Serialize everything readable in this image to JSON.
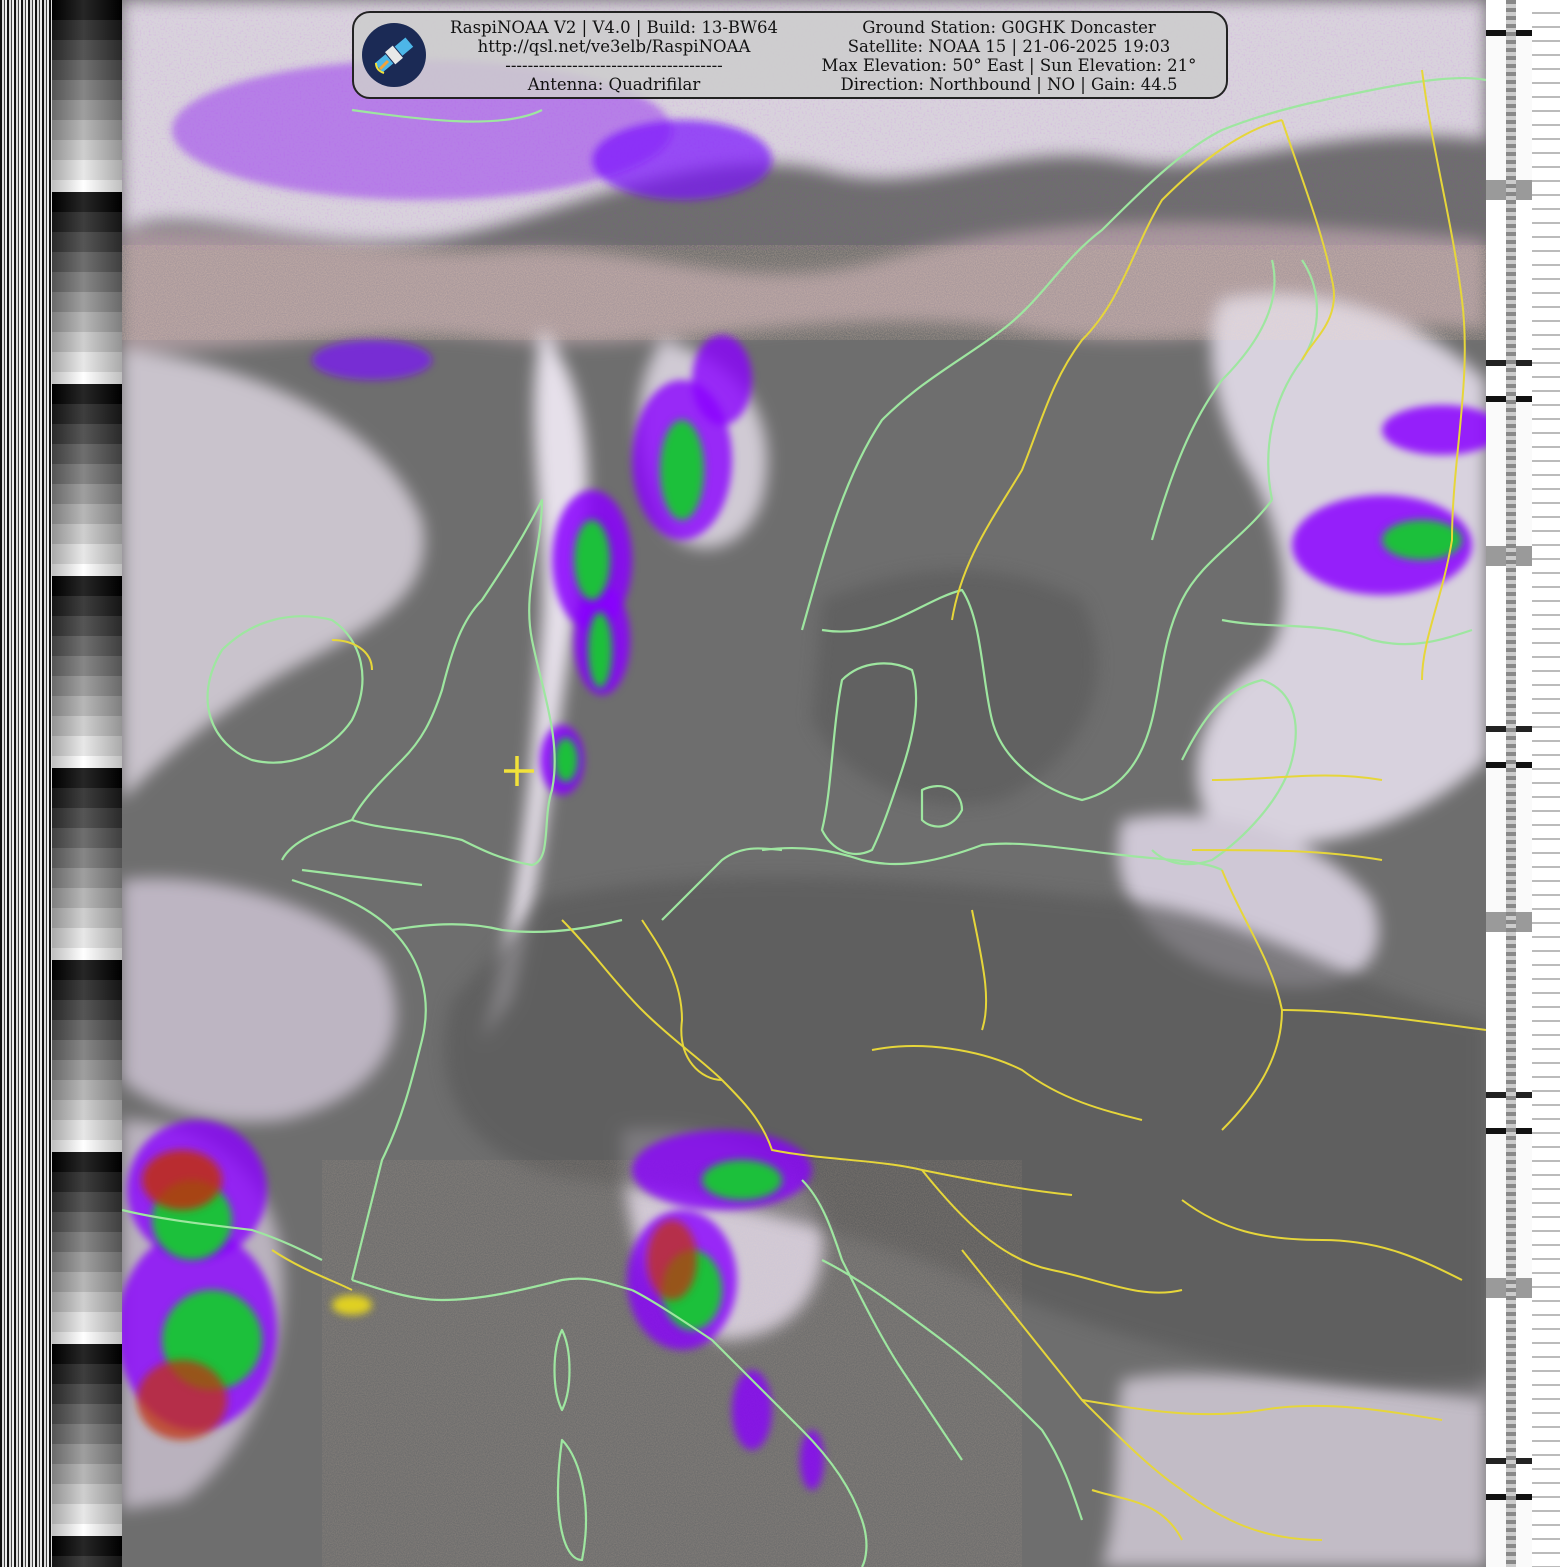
{
  "header": {
    "left_lines": [
      "RaspiNOAA V2 | V4.0 | Build: 13-BW64",
      "http://qsl.net/ve3elb/RaspiNOAA",
      "---------------------------------------",
      "Antenna: Quadrifilar"
    ],
    "right_lines": [
      "Ground Station: G0GHK Doncaster",
      "Satellite: NOAA 15 | 21-06-2025 19:03",
      "Max Elevation: 50° East | Sun Elevation: 21°",
      "Direction: Northbound | NO | Gain: 44.5"
    ],
    "logo_icon": "satellite-icon"
  },
  "map": {
    "colors": {
      "coastline": "#9ee6a0",
      "borders": "#e6d63a",
      "ground_station_marker": "#f2e23a",
      "cloud_cold": "#8a00ff",
      "cloud_colder": "#22c04a"
    },
    "marker_icon": "crosshair-icon"
  }
}
